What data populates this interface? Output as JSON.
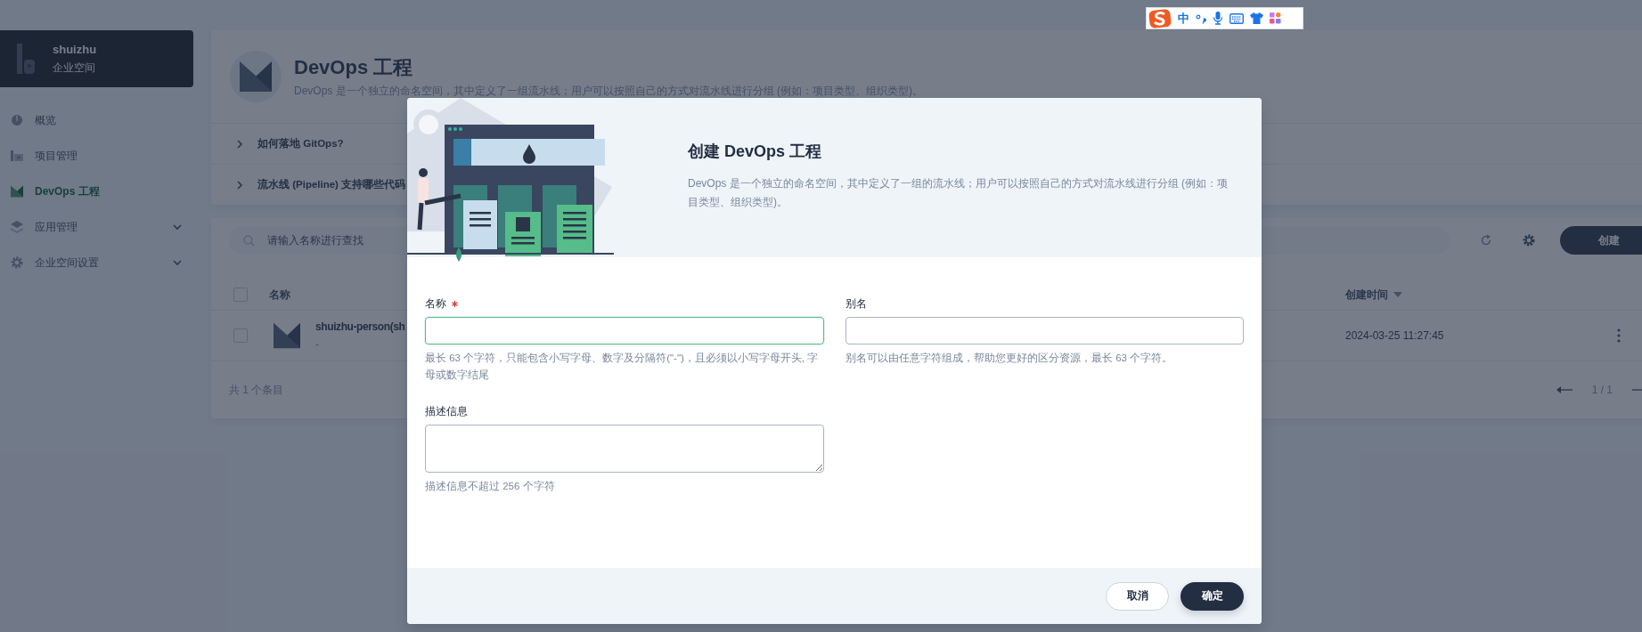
{
  "ime_toolbar": {
    "mode": "中"
  },
  "sidebar": {
    "workspace": {
      "name": "shuizhu",
      "label": "企业空间"
    },
    "items": [
      {
        "label": "概览",
        "selected": false,
        "kind": "link"
      },
      {
        "label": "项目管理",
        "selected": false,
        "kind": "link"
      },
      {
        "label": "DevOps 工程",
        "selected": true,
        "kind": "link"
      },
      {
        "label": "应用管理",
        "selected": false,
        "kind": "group"
      },
      {
        "label": "企业空间设置",
        "selected": false,
        "kind": "group"
      }
    ]
  },
  "page_header": {
    "title": "DevOps 工程",
    "description": "DevOps 是一个独立的命名空间，其中定义了一组流水线；用户可以按照自己的方式对流水线进行分组 (例如：项目类型、组织类型)。"
  },
  "faq": [
    {
      "label": "如何落地 GitOps?"
    },
    {
      "label": "流水线 (Pipeline) 支持哪些代码"
    }
  ],
  "toolbar": {
    "search_placeholder": "请输入名称进行查找",
    "create_button": "创建"
  },
  "table": {
    "header_checked": false,
    "columns": [
      {
        "label": "名称",
        "sortable": false
      },
      {
        "label": "创建时间",
        "sortable": true
      }
    ],
    "rows": [
      {
        "name": "shuizhu-person(sh",
        "description": "-",
        "created": "2024-03-25 11:27:45",
        "checked": false
      }
    ],
    "total": "共 1 个条目",
    "pagination": "1 / 1"
  },
  "dialog": {
    "title": "创建 DevOps 工程",
    "description": "DevOps 是一个独立的命名空间，其中定义了一组的流水线；用户可以按照自己的方式对流水线进行分组 (例如：项目类型、组织类型)。",
    "fields": [
      {
        "label": "名称",
        "required": true,
        "focused": true,
        "kind": "input",
        "hint": "最长 63 个字符，只能包含小写字母、数字及分隔符(\"-\")，且必须以小写字母开头, 字母或数字结尾"
      },
      {
        "label": "别名",
        "required": false,
        "focused": false,
        "kind": "input",
        "hint": "别名可以由任意字符组成，帮助您更好的区分资源，最长 63 个字符。"
      },
      {
        "label": "描述信息",
        "required": false,
        "focused": false,
        "kind": "textarea",
        "hint": "描述信息不超过 256 个字符"
      }
    ],
    "buttons": [
      {
        "label": "取消",
        "kind": "secondary"
      },
      {
        "label": "确定",
        "kind": "primary"
      }
    ]
  }
}
